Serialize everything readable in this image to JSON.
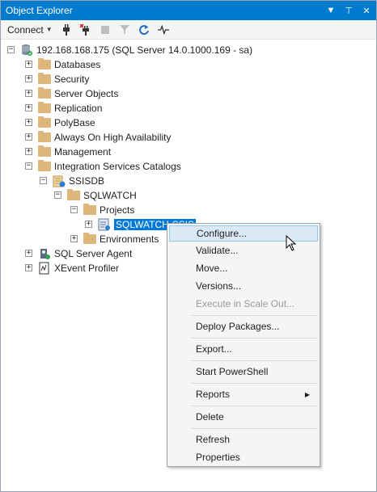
{
  "window": {
    "title": "Object Explorer",
    "buttons": [
      "▼",
      "⊤",
      "✕"
    ]
  },
  "toolbar": {
    "connect_label": "Connect",
    "icons": [
      "connect-icon",
      "disconnect-icon",
      "stop-icon",
      "filter-icon",
      "refresh-icon",
      "activity-monitor-icon"
    ]
  },
  "tree": {
    "server": "192.168.168.175 (SQL Server 14.0.1000.169 - sa)",
    "databases": "Databases",
    "security": "Security",
    "server_objects": "Server Objects",
    "replication": "Replication",
    "polybase": "PolyBase",
    "always_on": "Always On High Availability",
    "management": "Management",
    "isc": "Integration Services Catalogs",
    "ssisdb": "SSISDB",
    "sqlwatch_folder": "SQLWATCH",
    "projects": "Projects",
    "selected_project": "SQLWATCH-SSIS",
    "environments": "Environments",
    "agent": "SQL Server Agent",
    "xevent": "XEvent Profiler"
  },
  "context_menu": {
    "configure": "Configure...",
    "validate": "Validate...",
    "move": "Move...",
    "versions": "Versions...",
    "scale_out": "Execute in Scale Out...",
    "deploy": "Deploy Packages...",
    "export": "Export...",
    "powershell": "Start PowerShell",
    "reports": "Reports",
    "delete": "Delete",
    "refresh": "Refresh",
    "properties": "Properties"
  },
  "colors": {
    "titlebar": "#007acc",
    "selection": "#0078d7",
    "menu_highlight": "#dbe9f7",
    "folder": "#dcb67a"
  }
}
